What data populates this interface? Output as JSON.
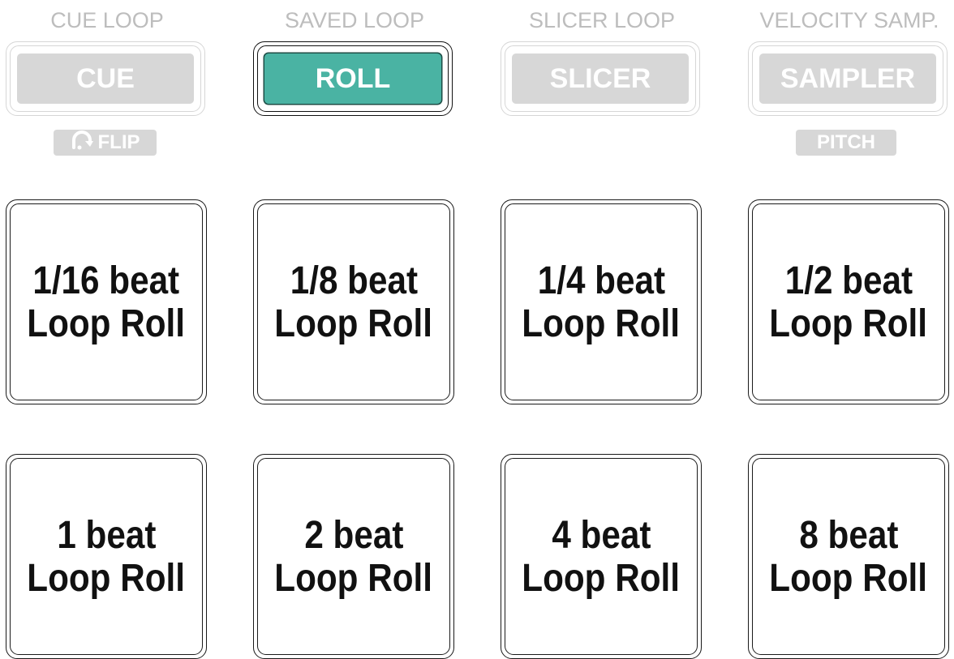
{
  "modes": [
    {
      "label": "CUE LOOP",
      "button": "CUE",
      "active": false,
      "sub": "FLIP",
      "sub_icon": "loop-arrow-icon"
    },
    {
      "label": "SAVED LOOP",
      "button": "ROLL",
      "active": true,
      "sub": null
    },
    {
      "label": "SLICER LOOP",
      "button": "SLICER",
      "active": false,
      "sub": null
    },
    {
      "label": "VELOCITY SAMP.",
      "button": "SAMPLER",
      "active": false,
      "sub": "PITCH"
    }
  ],
  "pads": [
    {
      "line1": "1/16 beat",
      "line2": "Loop Roll"
    },
    {
      "line1": "1/8 beat",
      "line2": "Loop Roll"
    },
    {
      "line1": "1/4 beat",
      "line2": "Loop Roll"
    },
    {
      "line1": "1/2 beat",
      "line2": "Loop Roll"
    },
    {
      "line1": "1 beat",
      "line2": "Loop Roll"
    },
    {
      "line1": "2 beat",
      "line2": "Loop Roll"
    },
    {
      "line1": "4 beat",
      "line2": "Loop Roll"
    },
    {
      "line1": "8 beat",
      "line2": "Loop Roll"
    }
  ],
  "colors": {
    "active_accent": "#4ab3a3",
    "inactive_gray": "#d7d7d7",
    "label_gray": "#bdbdbd"
  }
}
